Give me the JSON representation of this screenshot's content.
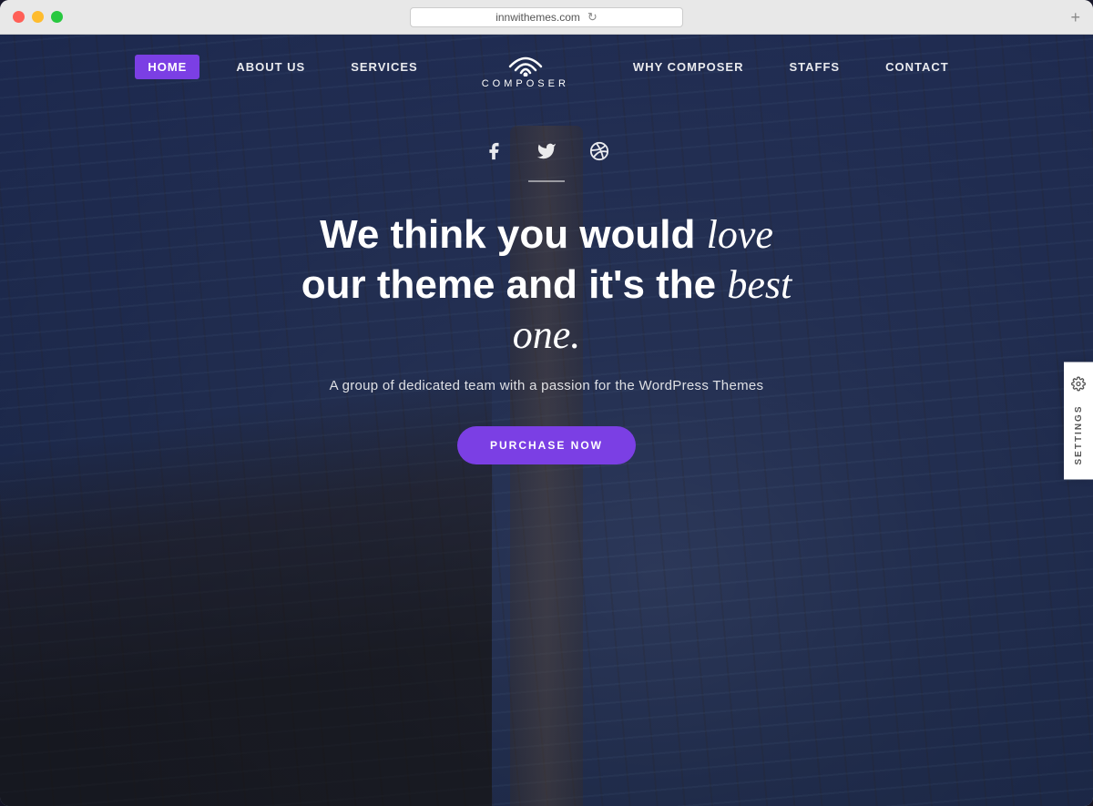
{
  "browser": {
    "url": "innwithemes.com",
    "reload_icon": "↻",
    "plus_icon": "+"
  },
  "navbar": {
    "logo_text": "COMPOSER",
    "items": [
      {
        "id": "home",
        "label": "HOME",
        "active": true
      },
      {
        "id": "about",
        "label": "ABOUT US",
        "active": false
      },
      {
        "id": "services",
        "label": "SERVICES",
        "active": false
      },
      {
        "id": "why-composer",
        "label": "WHY COMPOSER",
        "active": false
      },
      {
        "id": "staffs",
        "label": "STAFFS",
        "active": false
      },
      {
        "id": "contact",
        "label": "CONTACT",
        "active": false
      }
    ]
  },
  "hero": {
    "headline_part1": "We think you would ",
    "headline_italic1": "love",
    "headline_part2": "our theme and it's the ",
    "headline_italic2": "best",
    "headline_italic3": "one.",
    "headline_period": "",
    "subtitle": "A group of dedicated team with a passion for the WordPress Themes",
    "cta_label": "PURCHASE NOW",
    "social": {
      "facebook": "f",
      "twitter": "🐦",
      "dribbble": "◎"
    }
  },
  "settings": {
    "label": "SETTINGS",
    "gear_icon": "⚙"
  },
  "colors": {
    "accent": "#7b3fe4",
    "nav_active_bg": "#7b3fe4"
  }
}
